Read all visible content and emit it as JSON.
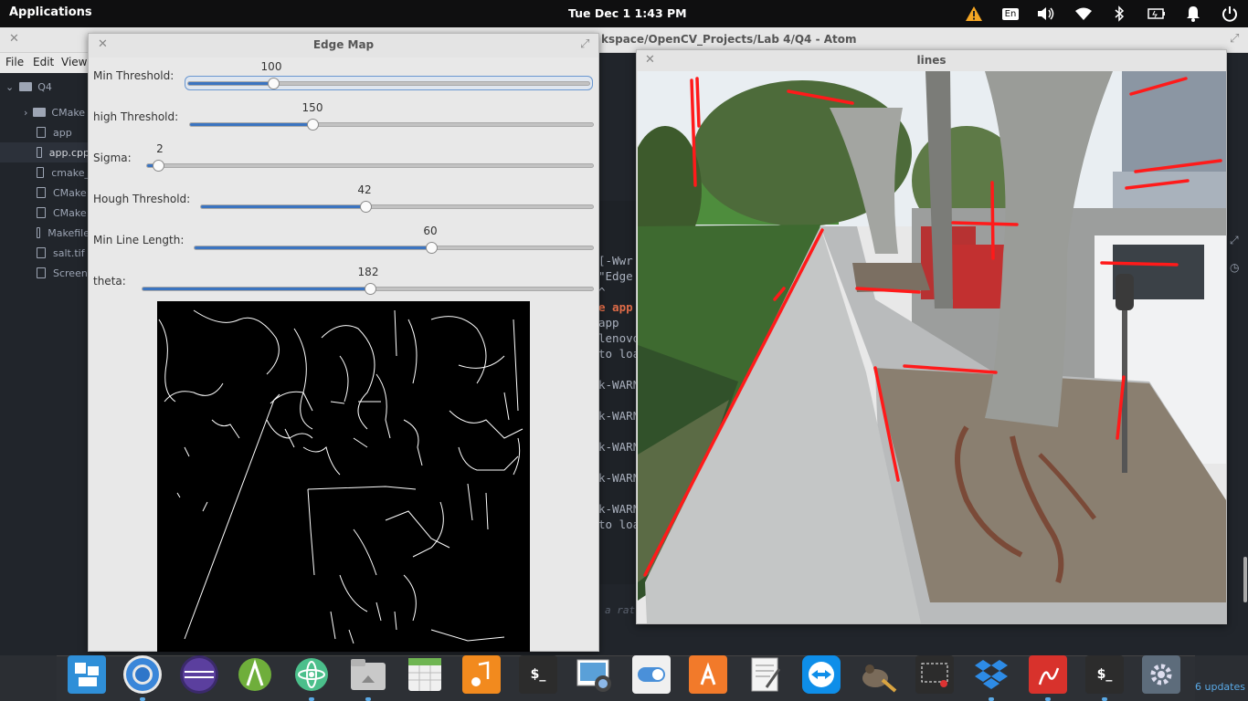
{
  "topbar": {
    "applications": "Applications",
    "clock": "Tue Dec  1   1:43 PM",
    "tray_icons": [
      "warning-icon",
      "keyboard-layout-icon",
      "volume-icon",
      "wifi-icon",
      "bluetooth-icon",
      "battery-icon",
      "notifications-icon",
      "power-icon"
    ],
    "keyboard_layout": "En"
  },
  "atom": {
    "title": "kspace/OpenCV_Projects/Lab 4/Q4 - Atom",
    "menu": [
      "File",
      "Edit",
      "View"
    ],
    "tree": {
      "root": "Q4",
      "items": [
        "CMake",
        "app",
        "app.cpp",
        "cmake_",
        "CMake",
        "CMake",
        "Makefile",
        "salt.tif",
        "Screen"
      ]
    },
    "editor_lines": [
      "[-Wwr",
      "\"Edge",
      "^",
      "e app",
      "app",
      "lenovo",
      "to loa",
      "",
      "k-WARN",
      "",
      "k-WARN",
      "",
      "k-WARN",
      "",
      "k-WARN",
      "",
      "k-WARN",
      "to loa"
    ],
    "bottom_hint": "a rat"
  },
  "edge_map": {
    "title": "Edge Map",
    "sliders": [
      {
        "label": "Min Threshold:",
        "value": "100",
        "fraction": 0.21
      },
      {
        "label": "high Threshold:",
        "value": "150",
        "fraction": 0.3
      },
      {
        "label": "Sigma:",
        "value": "2",
        "fraction": 0.03
      },
      {
        "label": "Hough Threshold:",
        "value": "42",
        "fraction": 0.42
      },
      {
        "label": "Min Line Length:",
        "value": "60",
        "fraction": 0.59
      },
      {
        "label": "theta:",
        "value": "182",
        "fraction": 0.5
      }
    ]
  },
  "lines_window": {
    "title": "lines"
  },
  "dock": {
    "apps": [
      "workspace-switcher",
      "chrome",
      "eclipse",
      "android-studio",
      "atom",
      "files",
      "calendar",
      "music",
      "terminal",
      "photos",
      "settings-toggle",
      "app-store",
      "text-editor",
      "teamviewer",
      "gimp",
      "screenshot",
      "dropbox",
      "pdf-reader",
      "terminal-2",
      "system-settings"
    ],
    "updates": "6 updates"
  },
  "colors": {
    "accent": "#3b74c0",
    "hough_line": "#ff1a1a"
  }
}
